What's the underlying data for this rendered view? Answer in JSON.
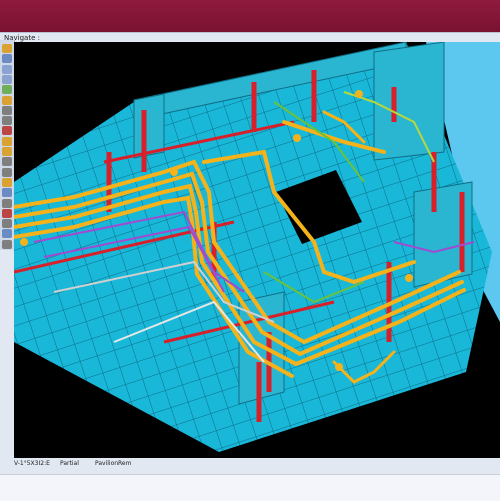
{
  "window": {
    "title": ""
  },
  "nav": {
    "label": "Navigate :"
  },
  "status": {
    "coords": "V-1°5X3I2:E",
    "field2": "Partial",
    "field3": "Pavilion",
    "field4": "Rem"
  },
  "toolbar": {
    "tools": [
      {
        "icon": "select-icon",
        "color": "#d9a233"
      },
      {
        "icon": "pan-icon",
        "color": "#6b8bc4"
      },
      {
        "icon": "zoom-in-icon",
        "color": "#8aa2d0"
      },
      {
        "icon": "zoom-out-icon",
        "color": "#8aa2d0"
      },
      {
        "icon": "rotate-icon",
        "color": "#6fae5a"
      },
      {
        "icon": "fit-icon",
        "color": "#d9a233"
      },
      {
        "icon": "walk-icon",
        "color": "#7f7f7f"
      },
      {
        "icon": "look-icon",
        "color": "#7f7f7f"
      },
      {
        "icon": "section-icon",
        "color": "#b44"
      },
      {
        "icon": "measure-icon",
        "color": "#d9a233"
      },
      {
        "icon": "box-icon",
        "color": "#d9a233"
      },
      {
        "icon": "hide-icon",
        "color": "#7f7f7f"
      },
      {
        "icon": "camera-icon",
        "color": "#7f7f7f"
      },
      {
        "icon": "light-icon",
        "color": "#d9a233"
      },
      {
        "icon": "layer-icon",
        "color": "#6b8bc4"
      },
      {
        "icon": "settings-icon",
        "color": "#7f7f7f"
      },
      {
        "icon": "clash-icon",
        "color": "#b44"
      },
      {
        "icon": "annotate-icon",
        "color": "#7f7f7f"
      },
      {
        "icon": "save-view-icon",
        "color": "#6b8bc4"
      },
      {
        "icon": "home-icon",
        "color": "#7f7f7f"
      }
    ]
  },
  "colors": {
    "structure": "#2fd0e8",
    "pipes": "#f4b21b",
    "beams": "#d8202a",
    "background": "#000000",
    "hull": "#5cc8f0"
  }
}
